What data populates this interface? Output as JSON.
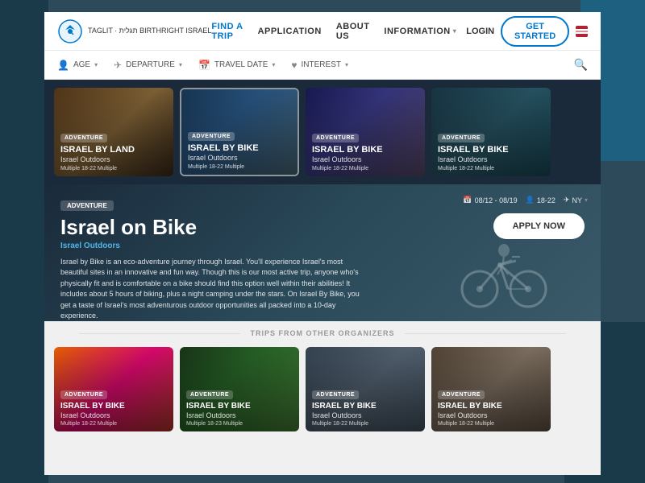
{
  "background": {
    "color": "#2d4a5a"
  },
  "navbar": {
    "logo_text": "TAGLIT · תגלית\nBIRTHRIGHT ISRAEL",
    "nav_items": [
      {
        "label": "FIND A TRIP",
        "active": true
      },
      {
        "label": "APPLICATION",
        "active": false
      },
      {
        "label": "ABOUT US",
        "active": false
      },
      {
        "label": "INFORMATION",
        "has_dropdown": true,
        "active": false
      }
    ],
    "login_label": "LOGIN",
    "get_started_label": "GET STARTED"
  },
  "filters": {
    "items": [
      {
        "icon": "person",
        "label": "AGE"
      },
      {
        "icon": "plane",
        "label": "DEPARTURE"
      },
      {
        "icon": "calendar",
        "label": "TRAVEL DATE"
      },
      {
        "icon": "heart",
        "label": "INTEREST"
      }
    ]
  },
  "trip_cards": [
    {
      "badge": "ADVENTURE",
      "title": "ISRAEL BY LAND",
      "subtitle": "Israel Outdoors",
      "meta": "Multiple  18-22  Multiple"
    },
    {
      "badge": "ADVENTURE",
      "title": "ISRAEL BY BIKE",
      "subtitle": "Israel Outdoors",
      "meta": "Multiple  18-22  Multiple",
      "active": true
    },
    {
      "badge": "ADVENTURE",
      "title": "ISRAEL BY BIKE",
      "subtitle": "Israel Outdoors",
      "meta": "Multiple  18-22  Multiple"
    },
    {
      "badge": "ADVENTURE",
      "title": "ISRAEL BY BIKE",
      "subtitle": "Israel Outdoors",
      "meta": "Multiple  18-22  Multiple"
    }
  ],
  "featured": {
    "badge": "ADVENTURE",
    "title": "Israel on Bike",
    "organizer": "Israel Outdoors",
    "description": "Israel by Bike is an eco-adventure journey through Israel. You'll experience Israel's most beautiful sites in an innovative and fun way. Though this is our most active trip, anyone who's physically fit and is comfortable on a bike should find this option well within their abilities! It includes about 5 hours of biking, plus a night camping under the stars. On Israel By Bike, you get a taste of Israel's most adventurous outdoor opportunities all packed into a 10-day experience.",
    "date": "08/12 - 08/19",
    "age": "18-22",
    "location": "NY",
    "apply_label": "APPLY NOW"
  },
  "trips_from_others": {
    "heading": "TRIPS FROM OTHER ORGANIZERS"
  },
  "bottom_cards": [
    {
      "badge": "ADVENTURE",
      "title": "ISRAEL BY BIKE",
      "subtitle": "Israel Outdoors",
      "meta": "Multiple  18-22  Multiple"
    },
    {
      "badge": "ADVENTURE",
      "title": "ISRAEL BY BIKE",
      "subtitle": "Israel Outdoors",
      "meta": "Multiple  18-23  Multiple"
    },
    {
      "badge": "ADVENTURE",
      "title": "ISRAEL BY BIKE",
      "subtitle": "Israel Outdoors",
      "meta": "Multiple  18-22  Multiple"
    },
    {
      "badge": "ADVENTURE",
      "title": "ISRAEL BY BIKE",
      "subtitle": "Israel Outdoors",
      "meta": "Multiple  18-22  Multiple"
    }
  ]
}
